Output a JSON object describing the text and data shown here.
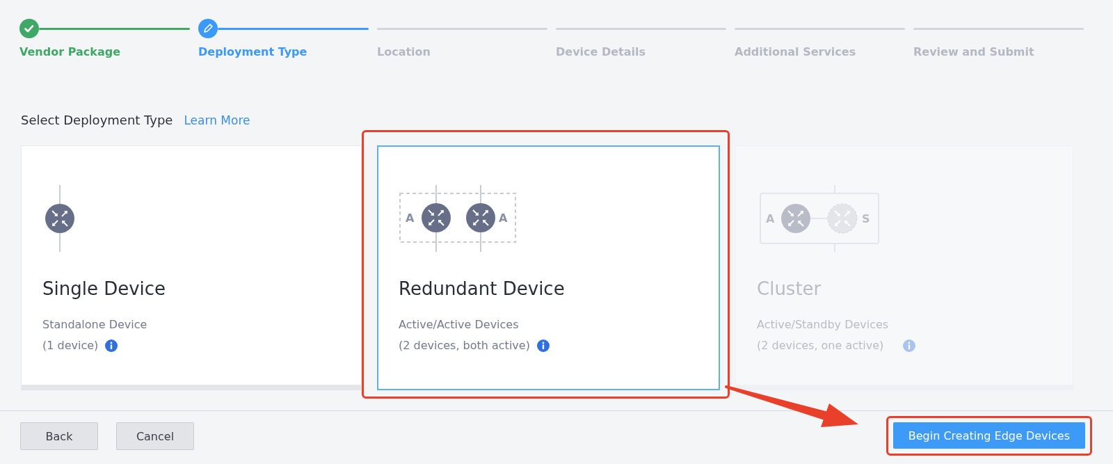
{
  "steps": [
    {
      "label": "Vendor Package",
      "done": true,
      "selected": false
    },
    {
      "label": "Deployment Type",
      "done": false,
      "selected": true
    },
    {
      "label": "Location",
      "done": false,
      "selected": false
    },
    {
      "label": "Device Details",
      "done": false,
      "selected": false
    },
    {
      "label": "Additional Services",
      "done": false,
      "selected": false
    },
    {
      "label": "Review and Submit",
      "done": false,
      "selected": false
    }
  ],
  "section": {
    "title": "Select Deployment Type",
    "link": "Learn More"
  },
  "cards": [
    {
      "kind": "single",
      "title": "Single Device",
      "subtitle": "Standalone Device",
      "detail": "(1 device)",
      "selected": false,
      "disabled": false,
      "highlighted": false
    },
    {
      "kind": "redundant",
      "title": "Redundant Device",
      "subtitle": "Active/Active Devices",
      "detail": "(2 devices, both active)",
      "icon_labels": [
        "A",
        "A"
      ],
      "selected": true,
      "disabled": false,
      "highlighted": true
    },
    {
      "kind": "cluster",
      "title": "Cluster",
      "subtitle": "Active/Standby Devices",
      "detail": "(2 devices, one active)",
      "icon_labels": [
        "A",
        "S"
      ],
      "selected": false,
      "disabled": true,
      "highlighted": false
    }
  ],
  "footer": {
    "buttons": [
      "Back",
      "Cancel"
    ],
    "primary": {
      "label": "Begin Creating Edge Devices",
      "highlighted": true
    },
    "annotation_arrow": true
  }
}
